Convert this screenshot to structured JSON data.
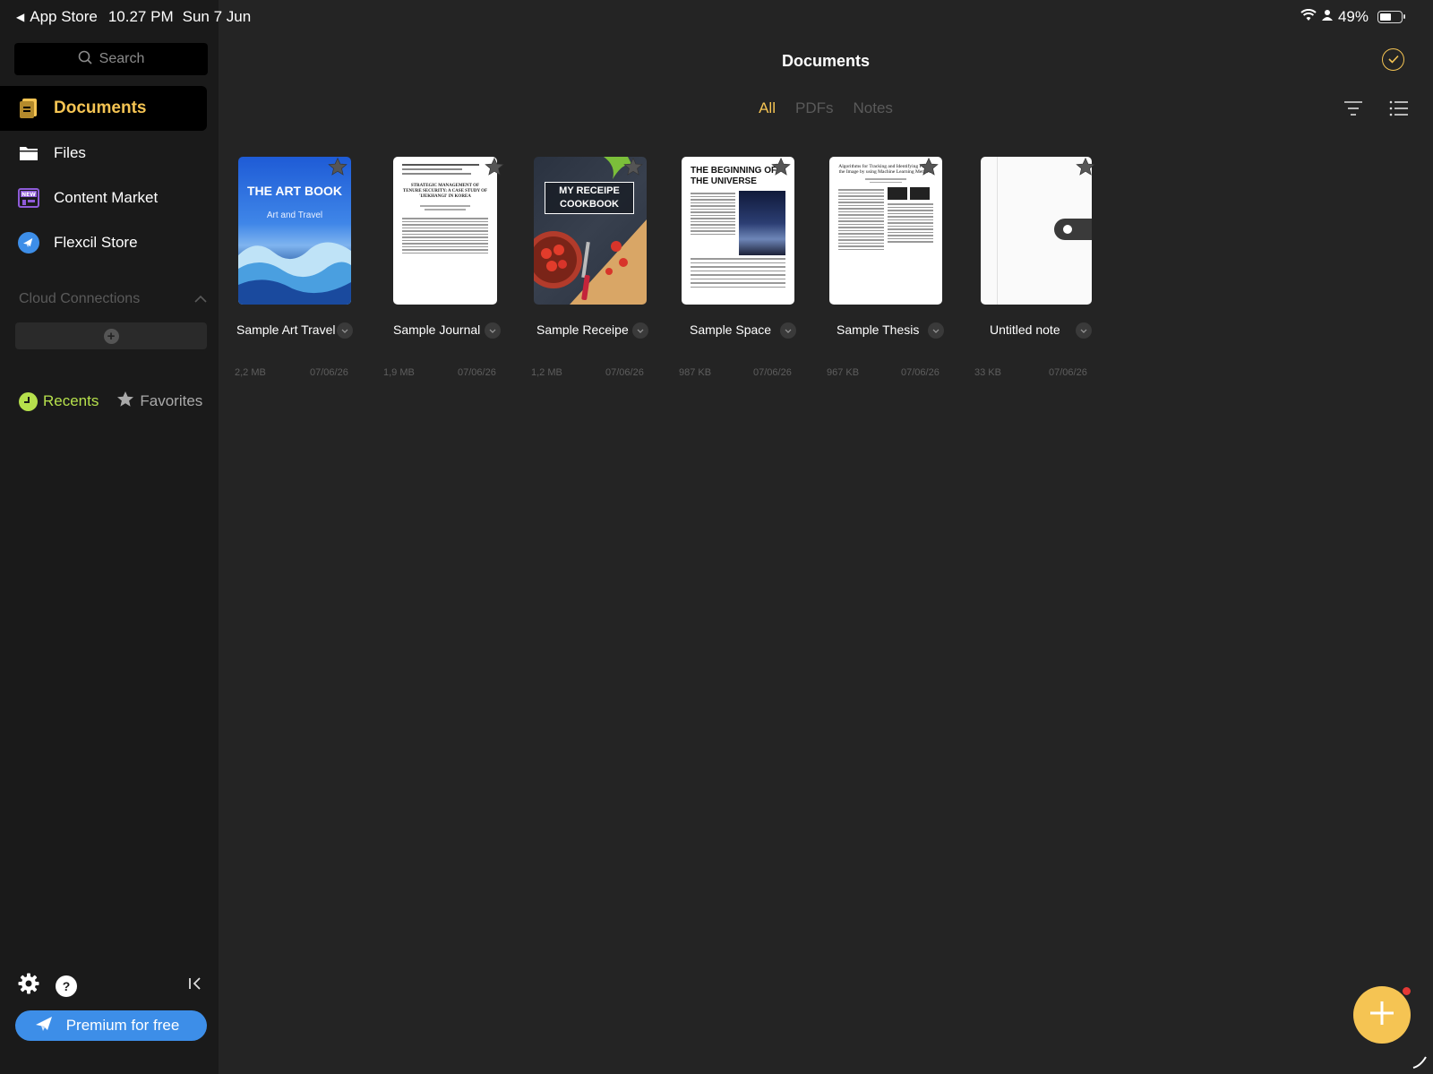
{
  "status_bar": {
    "back_app": "App Store",
    "time": "10.27 PM",
    "date": "Sun 7 Jun",
    "battery": "49%"
  },
  "sidebar": {
    "search_placeholder": "Search",
    "items": [
      {
        "label": "Documents",
        "icon": "documents-icon",
        "active": true
      },
      {
        "label": "Files",
        "icon": "folder-icon"
      },
      {
        "label": "Content Market",
        "icon": "market-new-icon",
        "badge": "NEW"
      },
      {
        "label": "Flexcil Store",
        "icon": "flexcil-store-icon"
      }
    ],
    "cloud_connections": "Cloud Connections",
    "recents": "Recents",
    "favorites": "Favorites",
    "premium_button": "Premium for free"
  },
  "main": {
    "title": "Documents",
    "filters": [
      "All",
      "PDFs",
      "Notes"
    ],
    "active_filter": "All",
    "documents": [
      {
        "name": "Sample Art Travel",
        "size": "2,2 MB",
        "date": "07/06/26",
        "cover_title": "THE ART BOOK",
        "cover_subtitle": "Art and Travel"
      },
      {
        "name": "Sample Journal",
        "size": "1,9 MB",
        "date": "07/06/26",
        "cover_title": "STRATEGIC MANAGEMENT OF TENURE SECURITY: A CASE STUDY OF 'IJEKHANGI' IN KOREA"
      },
      {
        "name": "Sample Receipe",
        "size": "1,2 MB",
        "date": "07/06/26",
        "cover_title": "MY RECEIPE COOKBOOK"
      },
      {
        "name": "Sample Space",
        "size": "987 KB",
        "date": "07/06/26",
        "cover_title": "THE BEGINNING OF THE UNIVERSE"
      },
      {
        "name": "Sample Thesis",
        "size": "967 KB",
        "date": "07/06/26",
        "cover_title": "Algorithms for Tracking and Identifying Pe... in the Image by using Machine Learning Methods"
      },
      {
        "name": "Untitled note",
        "size": "33 KB",
        "date": "07/06/26"
      }
    ]
  },
  "colors": {
    "accent": "#f5c453",
    "recents": "#b6e04c",
    "premium": "#3d8ee8",
    "background": "#242424",
    "sidebar": "#1a1a1a"
  }
}
